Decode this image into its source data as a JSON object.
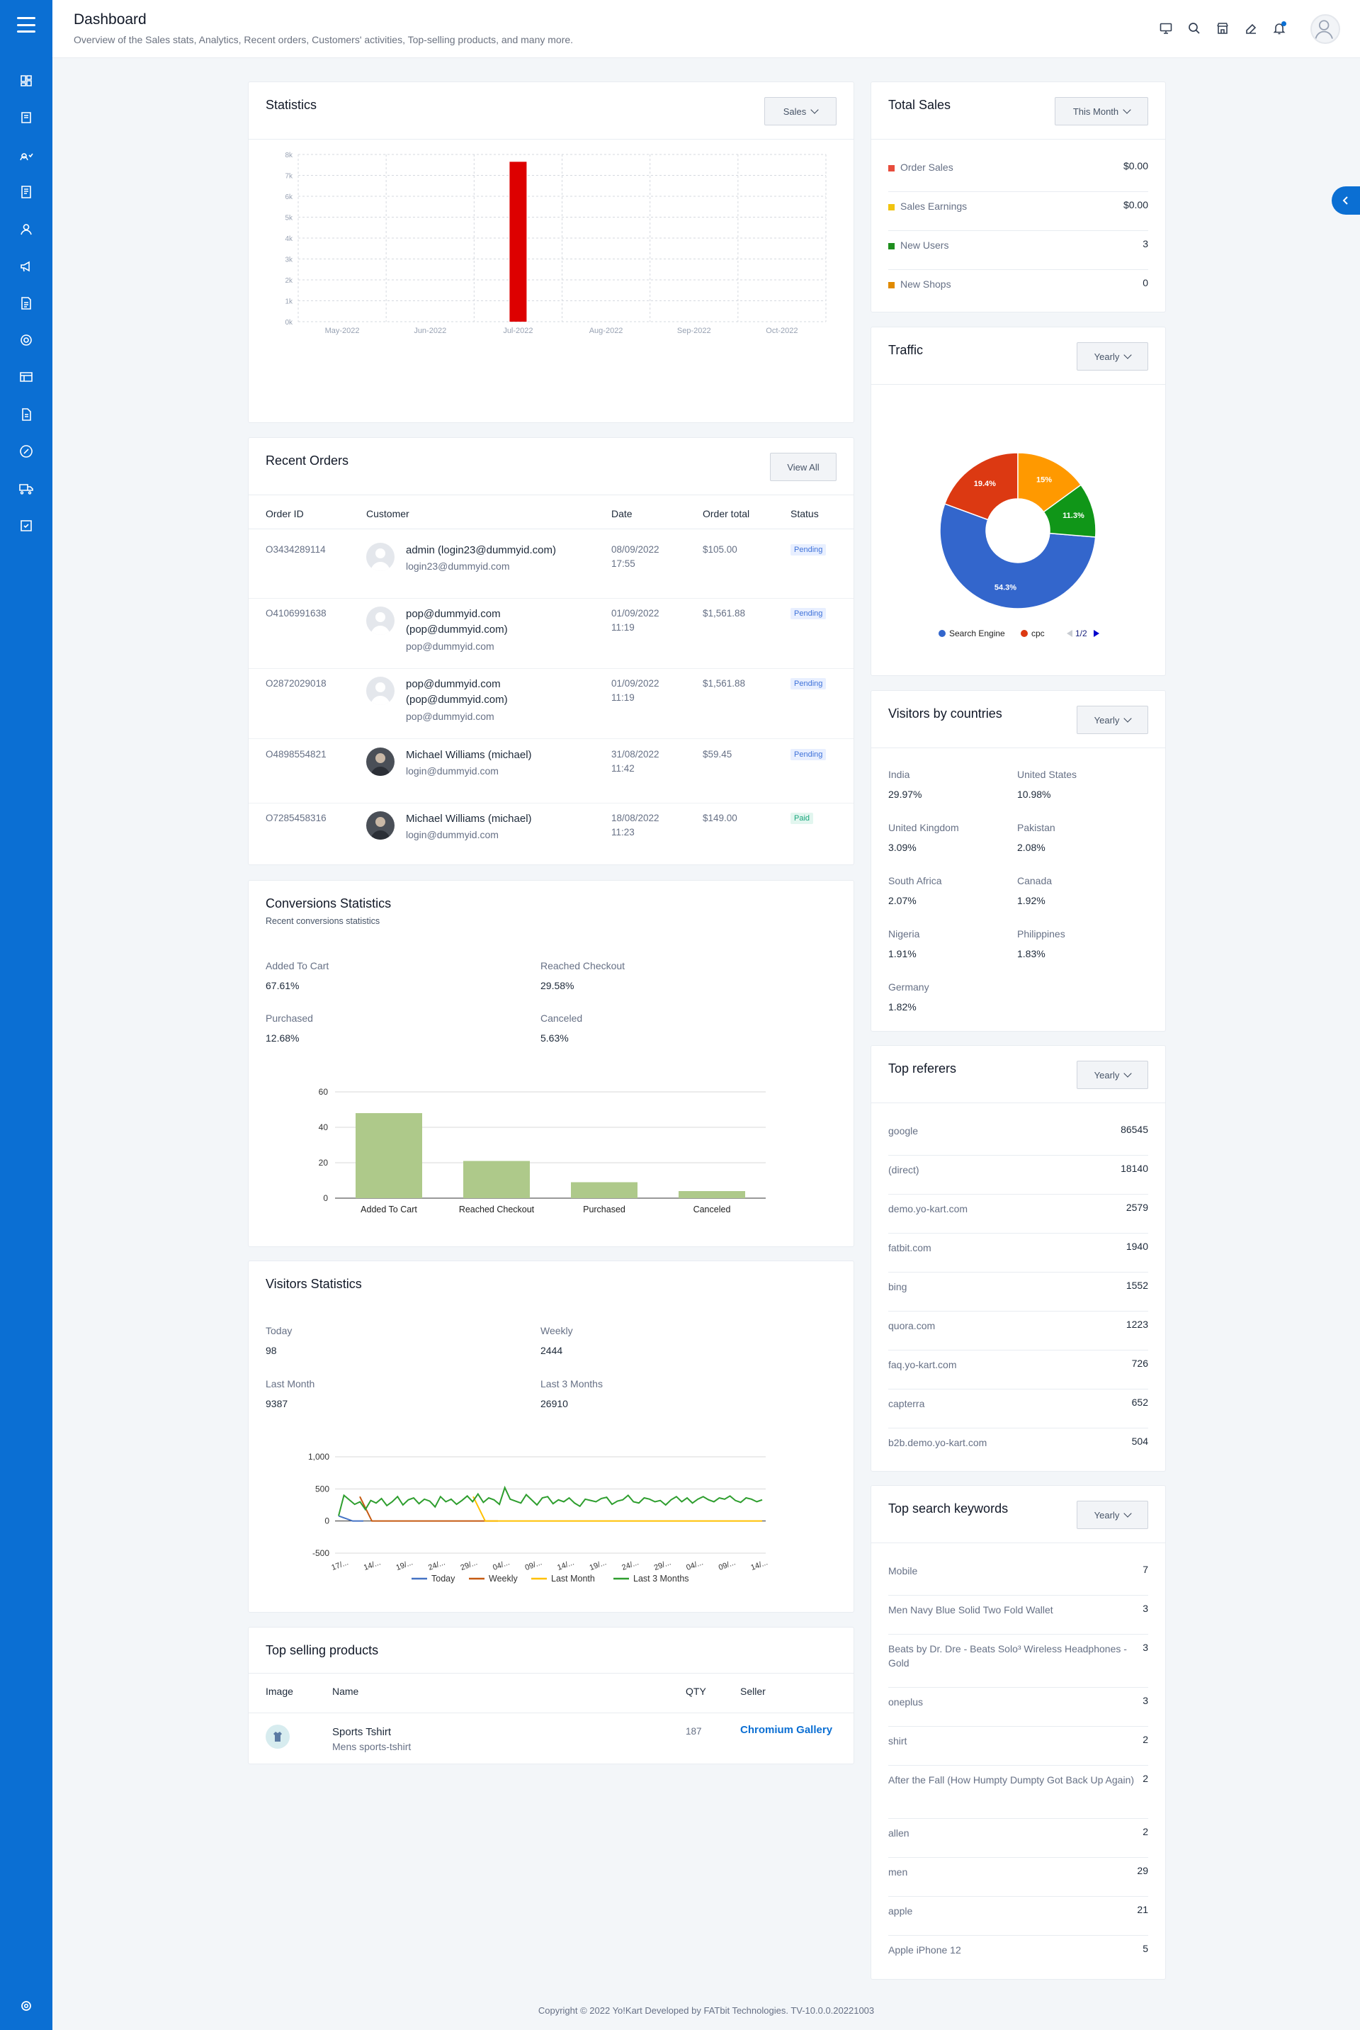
{
  "header": {
    "title": "Dashboard",
    "subtitle": "Overview of the Sales stats, Analytics, Recent orders, Customers' activities, Top-selling products, and many more."
  },
  "colors": {
    "brand": "#0b6fd3",
    "sales_bar": "#dd0000",
    "conversion_bar": "#aec98a"
  },
  "sidebar": {
    "icons": [
      "dashboard-icon",
      "catalog-icon",
      "users-icon",
      "orders-icon",
      "customer-icon",
      "promotions-icon",
      "reports-icon",
      "settings-icon",
      "cms-icon",
      "documents-icon",
      "tax-icon",
      "shipping-icon",
      "import-export-icon"
    ],
    "bottom_icon": "settings-icon"
  },
  "statistics": {
    "title": "Statistics",
    "dropdown": "Sales",
    "chart_data": {
      "type": "bar",
      "categories": [
        "May-2022",
        "Jun-2022",
        "Jul-2022",
        "Aug-2022",
        "Sep-2022",
        "Oct-2022"
      ],
      "values": [
        0,
        0,
        7650,
        0,
        0,
        0
      ],
      "y_ticks": [
        "0k",
        "1k",
        "2k",
        "3k",
        "4k",
        "5k",
        "6k",
        "7k",
        "8k"
      ],
      "ylim": [
        0,
        8000
      ],
      "grid": true
    }
  },
  "recent_orders": {
    "title": "Recent Orders",
    "view_all": "View All",
    "columns": [
      "Order ID",
      "Customer",
      "Date",
      "Order total",
      "Status"
    ],
    "rows": [
      {
        "id": "O3434289114",
        "name1": "admin (login23@dummyid.com)",
        "name2": "",
        "email": "login23@dummyid.com",
        "date1": "08/09/2022",
        "date2": "17:55",
        "total": "$105.00",
        "status": "Pending",
        "avatar": "default"
      },
      {
        "id": "O4106991638",
        "name1": "pop@dummyid.com",
        "name2": "(pop@dummyid.com)",
        "email": "pop@dummyid.com",
        "date1": "01/09/2022",
        "date2": "11:19",
        "total": "$1,561.88",
        "status": "Pending",
        "avatar": "default"
      },
      {
        "id": "O2872029018",
        "name1": "pop@dummyid.com",
        "name2": "(pop@dummyid.com)",
        "email": "pop@dummyid.com",
        "date1": "01/09/2022",
        "date2": "11:19",
        "total": "$1,561.88",
        "status": "Pending",
        "avatar": "default"
      },
      {
        "id": "O4898554821",
        "name1": "Michael Williams (michael)",
        "name2": "",
        "email": "login@dummyid.com",
        "date1": "31/08/2022",
        "date2": "11:42",
        "total": "$59.45",
        "status": "Pending",
        "avatar": "photo"
      },
      {
        "id": "O7285458316",
        "name1": "Michael Williams (michael)",
        "name2": "",
        "email": "login@dummyid.com",
        "date1": "18/08/2022",
        "date2": "11:23",
        "total": "$149.00",
        "status": "Paid",
        "avatar": "photo"
      }
    ]
  },
  "conversions": {
    "title": "Conversions Statistics",
    "subtitle": "Recent conversions statistics",
    "stats": [
      {
        "label": "Added To Cart",
        "value": "67.61%"
      },
      {
        "label": "Reached Checkout",
        "value": "29.58%"
      },
      {
        "label": "Purchased",
        "value": "12.68%"
      },
      {
        "label": "Canceled",
        "value": "5.63%"
      }
    ],
    "chart_data": {
      "type": "bar",
      "categories": [
        "Added To Cart",
        "Reached Checkout",
        "Purchased",
        "Canceled"
      ],
      "values": [
        48,
        21,
        9,
        4
      ],
      "y_ticks": [
        "0",
        "20",
        "40",
        "60"
      ],
      "ylim": [
        0,
        60
      ],
      "grid": true
    }
  },
  "visitors": {
    "title": "Visitors Statistics",
    "stats": [
      {
        "label": "Today",
        "value": "98"
      },
      {
        "label": "Weekly",
        "value": "2444"
      },
      {
        "label": "Last Month",
        "value": "9387"
      },
      {
        "label": "Last 3 Months",
        "value": "26910"
      }
    ],
    "chart_data": {
      "type": "line",
      "y_ticks": [
        "1,000",
        "500",
        "0",
        "-500"
      ],
      "ylim": [
        -500,
        1000
      ],
      "x_ticks": [
        "17/...",
        "14/...",
        "19/...",
        "24/...",
        "29/...",
        "04/...",
        "09/...",
        "14/...",
        "19/...",
        "24/...",
        "29/...",
        "04/...",
        "09/...",
        "14/..."
      ],
      "series": [
        {
          "name": "Today",
          "color": "#4472c4",
          "values": [
            0,
            0,
            0,
            0,
            0
          ]
        },
        {
          "name": "Weekly",
          "color": "#c55a11",
          "values": [
            0,
            0,
            0,
            0,
            0
          ]
        },
        {
          "name": "Last Month",
          "color": "#ffc000",
          "values": [
            0,
            0,
            0,
            0,
            0
          ]
        },
        {
          "name": "Last 3 Months",
          "color": "#2e9e2e",
          "values": [
            80,
            400,
            330,
            260,
            300,
            180,
            320,
            280,
            350,
            240,
            300,
            380,
            250,
            330,
            360,
            270,
            340,
            310,
            220,
            380,
            300,
            340,
            260,
            320,
            390,
            300,
            420,
            290,
            360,
            330,
            260,
            520,
            340,
            310,
            280,
            410,
            330,
            250,
            360,
            380,
            270,
            330,
            300,
            360,
            280,
            230,
            340,
            320,
            300,
            350,
            370,
            260,
            310,
            330,
            400,
            300,
            280,
            360,
            340,
            300,
            320,
            250,
            330,
            380,
            300,
            360,
            280,
            340,
            380,
            330,
            300,
            360,
            340,
            390,
            320,
            290,
            360,
            340,
            300,
            330
          ]
        }
      ]
    }
  },
  "top_selling": {
    "title": "Top selling products",
    "columns": [
      "Image",
      "Name",
      "QTY",
      "Seller"
    ],
    "rows": [
      {
        "name": "Sports Tshirt",
        "desc": "Mens sports-tshirt",
        "qty": "187",
        "seller": "Chromium Gallery"
      }
    ]
  },
  "total_sales": {
    "title": "Total Sales",
    "dropdown": "This Month",
    "items": [
      {
        "label": "Order Sales",
        "value": "$0.00",
        "color": "#e74c3c"
      },
      {
        "label": "Sales Earnings",
        "value": "$0.00",
        "color": "#f1c40f"
      },
      {
        "label": "New Users",
        "value": "3",
        "color": "#1e8e1e"
      },
      {
        "label": "New Shops",
        "value": "0",
        "color": "#e08a00"
      }
    ]
  },
  "traffic": {
    "title": "Traffic",
    "dropdown": "Yearly",
    "legend_page": "1/2",
    "chart_data": {
      "type": "pie",
      "slices": [
        {
          "name": "Search Engine",
          "value": 54.3,
          "label": "54.3%",
          "color": "#3366cc"
        },
        {
          "name": "cpc",
          "value": 19.4,
          "label": "19.4%",
          "color": "#dc3912"
        },
        {
          "name": "",
          "value": 15,
          "label": "15%",
          "color": "#ff9900"
        },
        {
          "name": "",
          "value": 11.3,
          "label": "11.3%",
          "color": "#109618"
        }
      ],
      "legend": [
        "Search Engine",
        "cpc"
      ]
    }
  },
  "countries": {
    "title": "Visitors by countries",
    "dropdown": "Yearly",
    "items": [
      {
        "name": "India",
        "value": "29.97%"
      },
      {
        "name": "United States",
        "value": "10.98%"
      },
      {
        "name": "United Kingdom",
        "value": "3.09%"
      },
      {
        "name": "Pakistan",
        "value": "2.08%"
      },
      {
        "name": "South Africa",
        "value": "2.07%"
      },
      {
        "name": "Canada",
        "value": "1.92%"
      },
      {
        "name": "Nigeria",
        "value": "1.91%"
      },
      {
        "name": "Philippines",
        "value": "1.83%"
      },
      {
        "name": "Germany",
        "value": "1.82%"
      }
    ]
  },
  "referers": {
    "title": "Top referers",
    "dropdown": "Yearly",
    "items": [
      {
        "name": "google",
        "value": "86545"
      },
      {
        "name": "(direct)",
        "value": "18140"
      },
      {
        "name": "demo.yo-kart.com",
        "value": "2579"
      },
      {
        "name": "fatbit.com",
        "value": "1940"
      },
      {
        "name": "bing",
        "value": "1552"
      },
      {
        "name": "quora.com",
        "value": "1223"
      },
      {
        "name": "faq.yo-kart.com",
        "value": "726"
      },
      {
        "name": "capterra",
        "value": "652"
      },
      {
        "name": "b2b.demo.yo-kart.com",
        "value": "504"
      }
    ]
  },
  "keywords": {
    "title": "Top search keywords",
    "dropdown": "Yearly",
    "items": [
      {
        "name": "Mobile",
        "value": "7"
      },
      {
        "name": "Men Navy Blue Solid Two Fold Wallet",
        "value": "3"
      },
      {
        "name": "Beats by Dr. Dre - Beats Solo³ Wireless Headphones - Gold",
        "value": "3"
      },
      {
        "name": "oneplus",
        "value": "3"
      },
      {
        "name": "shirt",
        "value": "2"
      },
      {
        "name": "After the Fall (How Humpty Dumpty Got Back Up Again)",
        "value": "2"
      },
      {
        "name": "allen",
        "value": "2"
      },
      {
        "name": "men",
        "value": "29"
      },
      {
        "name": "apple",
        "value": "21"
      },
      {
        "name": "Apple iPhone 12",
        "value": "5"
      }
    ]
  },
  "footer": {
    "text": "Copyright © 2022 Yo!Kart Developed by FATbit Technologies. TV-10.0.0.20221003"
  }
}
